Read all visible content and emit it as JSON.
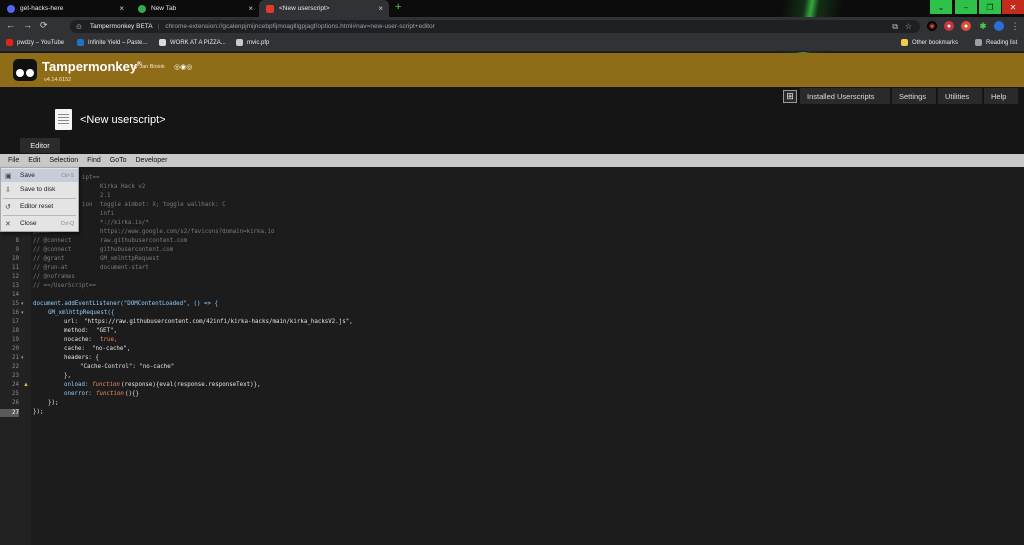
{
  "colors": {
    "accent_green": "#2ec24a",
    "header_gold": "#8f6c17",
    "editor_bg": "#1c1c1c",
    "menubar_bg": "#c9c9c9"
  },
  "browser": {
    "tabs": [
      {
        "title": "get-hacks-here",
        "icon": "discord-icon",
        "close": "×"
      },
      {
        "title": "New Tab",
        "icon": "chrome-icon",
        "close": "×"
      },
      {
        "title": "<New userscript>",
        "icon": "tampermonkey-icon",
        "close": "×"
      }
    ],
    "new_tab": "+",
    "window_controls": [
      "⌄",
      "–",
      "❐",
      "✕"
    ],
    "nav": {
      "back": "←",
      "forward": "→",
      "reload": "⟳",
      "secure": "⊙"
    },
    "site_name": "Tampermonkey BETA",
    "url": "chrome-extension://gcalenpjmijncebpfijmoaglllgpjagf/options.html#nav=new-user-script+editor",
    "bookmarks": [
      {
        "label": "pwdzy – YouTube",
        "icon": "youtube-icon"
      },
      {
        "label": "Infinite Yield – Paste...",
        "icon": "pastebin-icon"
      },
      {
        "label": "WORK AT A PIZZA...",
        "icon": "roblox-icon"
      },
      {
        "label": "mvic.pfp",
        "icon": "image-icon"
      }
    ],
    "other_bookmarks": "Other bookmarks",
    "reading_list": "Reading list"
  },
  "tampermonkey": {
    "title": "Tampermonkey",
    "registered": "®",
    "by": "by Jan Biniok",
    "version": "v4.14.6152",
    "nav": [
      "Installed Userscripts",
      "Settings",
      "Utilities",
      "Help"
    ],
    "add_icon": "⊞",
    "script_title": "<New userscript>",
    "editor_tab": "Editor"
  },
  "menubar": [
    "File",
    "Edit",
    "Selection",
    "Find",
    "GoTo",
    "Developer"
  ],
  "file_menu": [
    {
      "label": "Save",
      "shortcut": "Ctrl-S",
      "icon": "save-icon",
      "glyph": "▣"
    },
    {
      "label": "Save to disk",
      "shortcut": "",
      "icon": "download-icon",
      "glyph": "⇩"
    },
    {
      "label": "Editor reset",
      "shortcut": "",
      "icon": "reset-icon",
      "glyph": "↺"
    },
    {
      "label": "Close",
      "shortcut": "Ctrl-Q",
      "icon": "close-icon",
      "glyph": "✕"
    }
  ],
  "code": {
    "line_numbers": [
      "8",
      "9",
      "10",
      "11",
      "12",
      "13",
      "14",
      "15",
      "16",
      "17",
      "18",
      "19",
      "20",
      "21",
      "22",
      "23",
      "24",
      "25",
      "26",
      "27"
    ],
    "header_fragments": {
      "l1": "ipt==",
      "l2_val": "Kirka Hack v2",
      "l3_val": "2.1",
      "l4_key": "ion",
      "l4_val": "toggle aimbot: X; toggle wallhack: C",
      "l5_val": "infi",
      "l6_val": "*://kirka.io/*",
      "l7_key": "@icon",
      "l7_val": "https://www.google.com/s2/favicons?domain=kirka.io"
    },
    "meta": [
      {
        "key": "// @connect",
        "val": "raw.githubusercontent.com"
      },
      {
        "key": "// @connect",
        "val": "githubusercontent.com"
      },
      {
        "key": "// @grant",
        "val": "GM_xmlhttpRequest"
      },
      {
        "key": "// @run-at",
        "val": "document-start"
      },
      {
        "key": "// @noframes",
        "val": ""
      },
      {
        "key": "// ==/UserScript==",
        "val": ""
      }
    ],
    "body": {
      "l15": "document.addEventListener(\"DOMContentLoaded\", () => {",
      "l16": "GM_xmlhttpRequest({",
      "l17_key": "url:",
      "l17_val": "\"https://raw.githubusercontent.com/42infi/kirka-hacks/main/kirka_hacksV2.js\",",
      "l18_key": "method:",
      "l18_val": "\"GET\",",
      "l19_key": "nocache:",
      "l19_val": "true,",
      "l20_key": "cache:",
      "l20_val": "\"no-cache\",",
      "l21": "headers: {",
      "l22": "\"Cache-Control\": \"no-cache\"",
      "l23": "},",
      "l24_key": "onload:",
      "l24_fn": "function",
      "l24_rest": "(response){eval(response.responseText)},",
      "l25_key": "onerror:",
      "l25_fn": "function",
      "l25_rest": "(){}",
      "l26": "});",
      "l27": "});"
    }
  }
}
